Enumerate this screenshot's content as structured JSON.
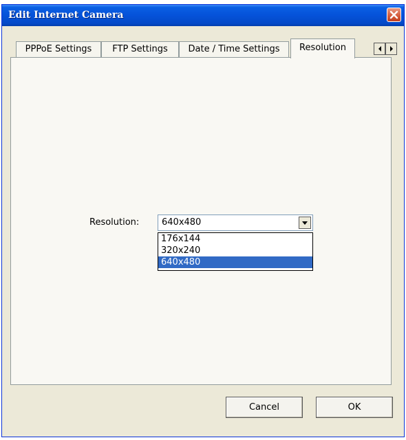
{
  "window": {
    "title": "Edit Internet Camera",
    "close_icon": "close-icon"
  },
  "tabs": [
    {
      "label": "PPPoE Settings",
      "active": false
    },
    {
      "label": "FTP Settings",
      "active": false
    },
    {
      "label": "Date / Time Settings",
      "active": false
    },
    {
      "label": "Resolution",
      "active": true
    }
  ],
  "tab_scroll": {
    "left_icon": "chevron-left-icon",
    "right_icon": "chevron-right-icon"
  },
  "resolution": {
    "label": "Resolution:",
    "selected": "640x480",
    "options": [
      "176x144",
      "320x240",
      "640x480"
    ]
  },
  "buttons": {
    "cancel": "Cancel",
    "ok": "OK"
  },
  "colors": {
    "titlebar": "#0552d9",
    "dialog_bg": "#ece9d8",
    "selection": "#316ac5",
    "close_button": "#d45a39"
  }
}
